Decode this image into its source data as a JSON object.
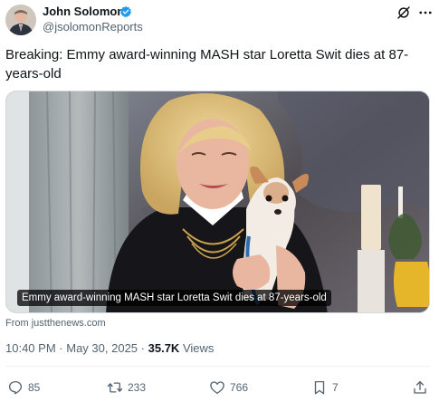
{
  "author": {
    "name": "John Solomon",
    "handle": "@jsolomonReports",
    "verified": true
  },
  "tweet": {
    "text": "Breaking: Emmy award-winning MASH star Loretta Swit dies at 87-years-old"
  },
  "media": {
    "caption": "Emmy award-winning MASH star Loretta Swit dies at 87-years-old",
    "source": "From justthenews.com"
  },
  "meta": {
    "time": "10:40 PM",
    "separator1": "·",
    "date": "May 30, 2025",
    "separator2": "·",
    "views_count": "35.7K",
    "views_label": "Views"
  },
  "actions": {
    "replies": "85",
    "reposts": "233",
    "likes": "766",
    "bookmarks": "7"
  },
  "colors": {
    "verified": "#1d9bf0",
    "secondary_text": "#536471",
    "primary_text": "#0f1419"
  },
  "icons": [
    "verified-badge-icon",
    "grok-icon",
    "more-icon",
    "reply-icon",
    "repost-icon",
    "like-icon",
    "bookmark-icon",
    "share-icon"
  ]
}
